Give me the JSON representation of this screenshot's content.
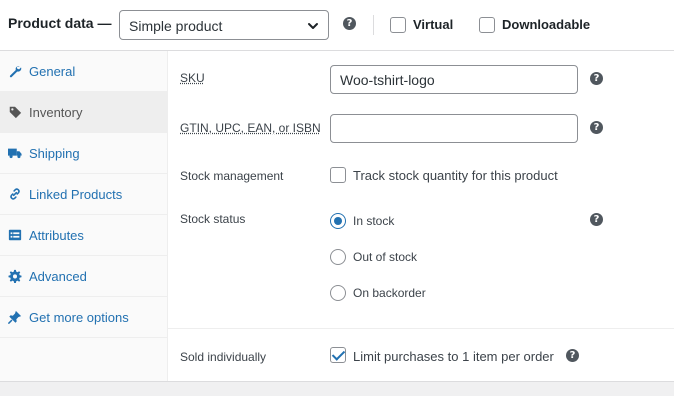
{
  "header": {
    "title": "Product data —",
    "product_type": "Simple product",
    "help_glyph": "?",
    "virtual_label": "Virtual",
    "downloadable_label": "Downloadable",
    "virtual_checked": false,
    "downloadable_checked": false
  },
  "sidebar": {
    "active": "Inventory",
    "accent_color": "#2271b1",
    "items": [
      {
        "label": "General",
        "icon": "wrench-icon"
      },
      {
        "label": "Inventory",
        "icon": "tag-icon"
      },
      {
        "label": "Shipping",
        "icon": "truck-icon"
      },
      {
        "label": "Linked Products",
        "icon": "link-icon"
      },
      {
        "label": "Attributes",
        "icon": "list-icon"
      },
      {
        "label": "Advanced",
        "icon": "gear-icon"
      },
      {
        "label": "Get more options",
        "icon": "plugin-icon"
      }
    ]
  },
  "inventory": {
    "sku_label": "SKU",
    "sku_value": "Woo-tshirt-logo",
    "gtin_label": "GTIN, UPC, EAN, or ISBN",
    "gtin_value": "",
    "stock_management_label": "Stock management",
    "track_stock_label": "Track stock quantity for this product",
    "track_stock_checked": false,
    "stock_status_label": "Stock status",
    "stock_status_options": [
      "In stock",
      "Out of stock",
      "On backorder"
    ],
    "stock_status_selected": "In stock",
    "sold_individually_label": "Sold individually",
    "limit_purchases_label": "Limit purchases to 1 item per order",
    "limit_purchases_checked": true
  }
}
